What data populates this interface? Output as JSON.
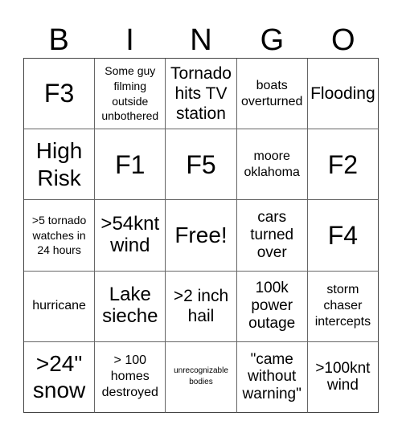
{
  "card": {
    "header": [
      "B",
      "I",
      "N",
      "G",
      "O"
    ],
    "rows": [
      [
        "F3",
        "Some guy filming outside unbothered",
        "Tornado hits TV station",
        "boats overturned",
        "Flooding"
      ],
      [
        "High Risk",
        "F1",
        "F5",
        "moore oklahoma",
        "F2"
      ],
      [
        ">5 tornado watches in 24 hours",
        ">54knt wind",
        "Free!",
        "cars turned over",
        "F4"
      ],
      [
        "hurricane",
        "Lake sieche",
        ">2 inch hail",
        "100k power outage",
        "storm chaser intercepts"
      ],
      [
        ">24\" snow",
        "> 100 homes destroyed",
        "unrecognizable bodies",
        "\"came without warning\"",
        ">100knt wind"
      ]
    ],
    "free_space": "Free!"
  }
}
